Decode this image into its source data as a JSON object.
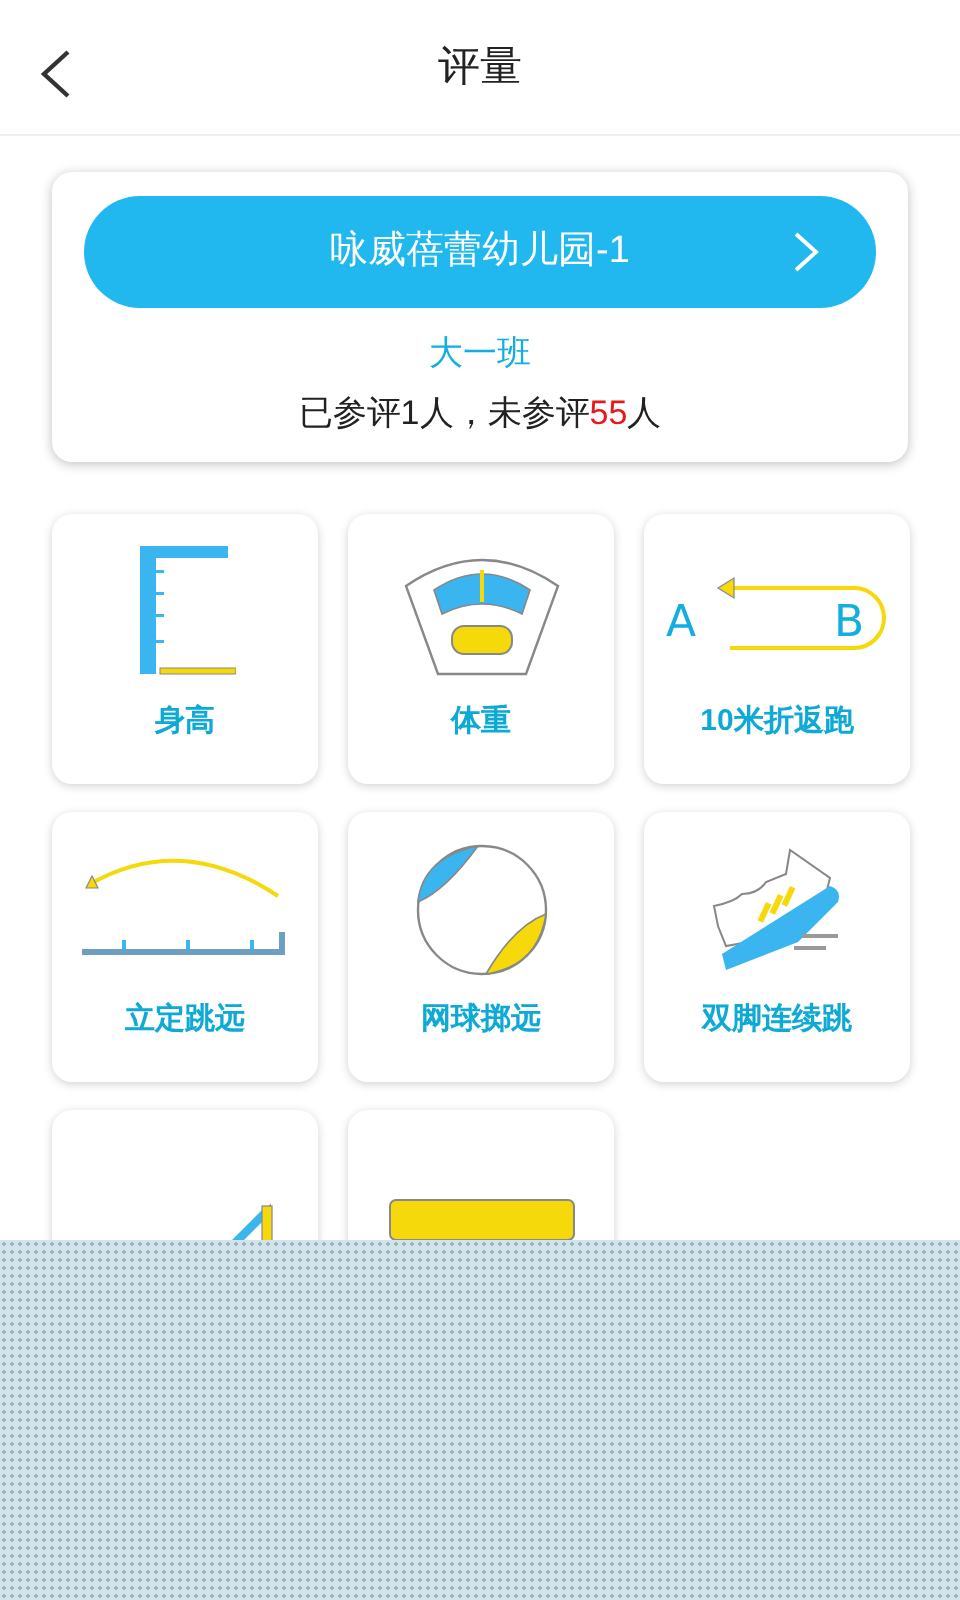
{
  "header": {
    "title": "评量"
  },
  "school": {
    "name": "咏威蓓蕾幼儿园-1",
    "class_name": "大一班",
    "progress_before": "已参评1人，未参评",
    "pending_count": "55",
    "progress_after": "人"
  },
  "items": [
    {
      "kind": "height",
      "label": "身高"
    },
    {
      "kind": "weight",
      "label": "体重"
    },
    {
      "kind": "shuttle",
      "label": "10米折返跑",
      "start": "A",
      "end": "B"
    },
    {
      "kind": "longjump",
      "label": "立定跳远"
    },
    {
      "kind": "ball",
      "label": "网球掷远"
    },
    {
      "kind": "shoe",
      "label": "双脚连续跳"
    },
    {
      "kind": "ramp"
    },
    {
      "kind": "beam"
    }
  ]
}
